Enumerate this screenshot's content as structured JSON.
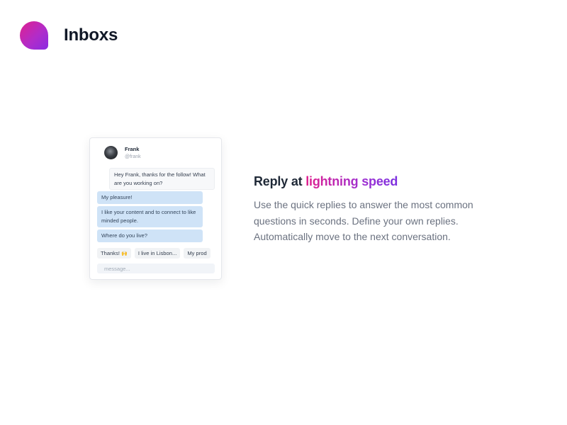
{
  "app": {
    "name": "Inboxs"
  },
  "chat": {
    "contact": {
      "name": "Frank",
      "handle": "@frank"
    },
    "messages": [
      {
        "direction": "incoming",
        "text": "Hey Frank, thanks for the follow! What are you working on?"
      },
      {
        "direction": "outgoing",
        "text": "My pleasure!"
      },
      {
        "direction": "outgoing",
        "text": "I like your content and to connect to like minded people."
      },
      {
        "direction": "outgoing",
        "text": "Where do you live?"
      }
    ],
    "quick_replies": [
      {
        "label": "Thanks!",
        "emoji": "🙌"
      },
      {
        "label": "I live in Lisbon..."
      },
      {
        "label": "My prod"
      }
    ],
    "input": {
      "placeholder": "message...",
      "value": ""
    }
  },
  "feature": {
    "title_prefix": "Reply at ",
    "title_highlight": "lightning speed",
    "description": "Use the quick replies to answer the most common questions in seconds. Define your own replies. Automatically move to the next conversation."
  },
  "colors": {
    "brand_gradient_start": "#e0208e",
    "brand_gradient_end": "#8a2be2",
    "outgoing_bubble": "#cfe3f7",
    "text_primary": "#1f2937",
    "text_secondary": "#6b7280"
  },
  "icons": {
    "logo": "speech-bubble-logo-icon",
    "avatar": "contact-avatar"
  }
}
